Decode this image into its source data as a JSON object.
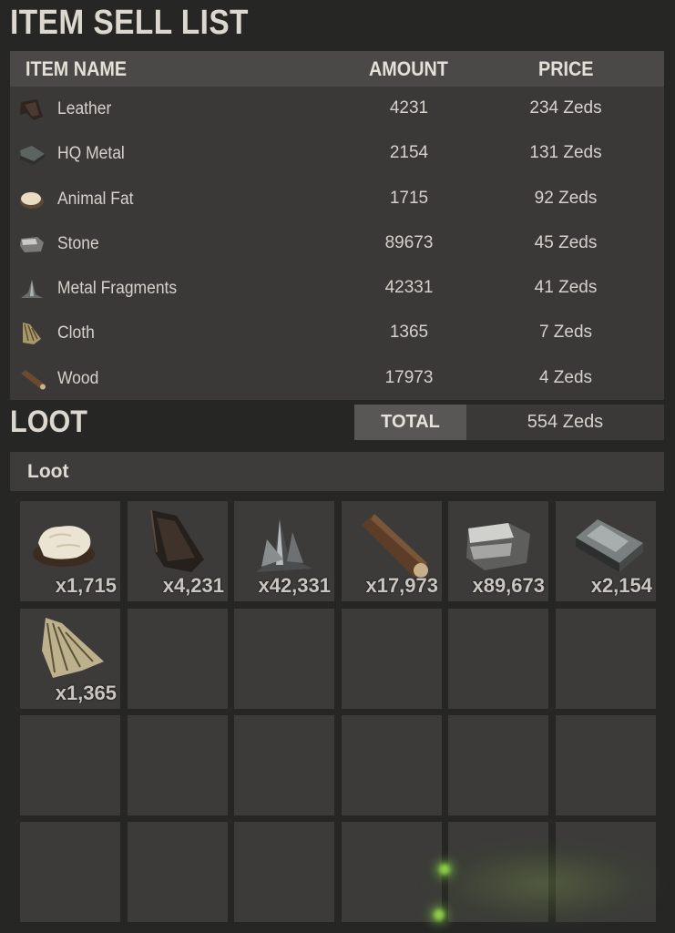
{
  "title": "ITEM SELL LIST",
  "table": {
    "headers": {
      "name": "ITEM NAME",
      "amount": "AMOUNT",
      "price": "PRICE"
    },
    "rows": [
      {
        "name": "Leather",
        "amount": "4231",
        "price": "234 Zeds",
        "icon": "leather-icon"
      },
      {
        "name": "HQ Metal",
        "amount": "2154",
        "price": "131 Zeds",
        "icon": "hq-metal-icon"
      },
      {
        "name": "Animal Fat",
        "amount": "1715",
        "price": "92 Zeds",
        "icon": "animal-fat-icon"
      },
      {
        "name": "Stone",
        "amount": "89673",
        "price": "45 Zeds",
        "icon": "stone-icon"
      },
      {
        "name": "Metal Fragments",
        "amount": "42331",
        "price": "41 Zeds",
        "icon": "metal-fragments-icon"
      },
      {
        "name": "Cloth",
        "amount": "1365",
        "price": "7 Zeds",
        "icon": "cloth-icon"
      },
      {
        "name": "Wood",
        "amount": "17973",
        "price": "4 Zeds",
        "icon": "wood-icon"
      }
    ]
  },
  "loot_title": "LOOT",
  "total": {
    "label": "TOTAL",
    "value": "554 Zeds"
  },
  "loot_panel": {
    "label": "Loot"
  },
  "slots": [
    {
      "icon": "animal-fat-icon",
      "qty": "x1,715"
    },
    {
      "icon": "leather-icon",
      "qty": "x4,231"
    },
    {
      "icon": "metal-fragments-icon",
      "qty": "x42,331"
    },
    {
      "icon": "wood-icon",
      "qty": "x17,973"
    },
    {
      "icon": "stone-icon",
      "qty": "x89,673"
    },
    {
      "icon": "hq-metal-icon",
      "qty": "x2,154"
    },
    {
      "icon": "cloth-icon",
      "qty": "x1,365"
    }
  ],
  "empty_slot_count": 17,
  "colors": {
    "background": "#262625",
    "panel": "#3a3938",
    "header": "#4a4948",
    "slot": "#3c3b3a"
  }
}
